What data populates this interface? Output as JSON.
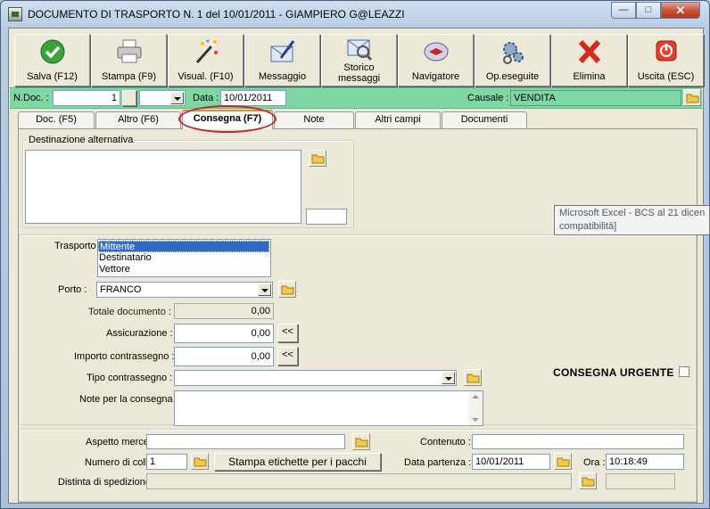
{
  "window": {
    "title": "DOCUMENTO DI TRASPORTO N. 1  del 10/01/2011 - GIAMPIERO G@LEAZZI",
    "min": "—",
    "max": "□",
    "close": "✕"
  },
  "toolbar": [
    {
      "label": "Salva (F12)",
      "icon": "save-check-icon"
    },
    {
      "label": "Stampa (F9)",
      "icon": "printer-icon"
    },
    {
      "label": "Visual. (F10)",
      "icon": "magic-wand-icon"
    },
    {
      "label": "Messaggio",
      "icon": "mail-pen-icon"
    },
    {
      "label": "Storico messaggi",
      "icon": "mail-search-icon"
    },
    {
      "label": "Navigatore",
      "icon": "compass-icon"
    },
    {
      "label": "Op.eseguite",
      "icon": "gears-icon"
    },
    {
      "label": "Elimina",
      "icon": "red-x-icon"
    },
    {
      "label": "Uscita (ESC)",
      "icon": "power-icon"
    }
  ],
  "header": {
    "ndoc_label": "N.Doc. :",
    "ndoc_value": "1",
    "data_label": "Data :",
    "data_value": "10/01/2011",
    "causale_label": "Causale :",
    "causale_value": "VENDITA"
  },
  "tabs": [
    "Doc. (F5)",
    "Altro (F6)",
    "Consegna (F7)",
    "Note",
    "Altri campi",
    "Documenti"
  ],
  "destinazione": {
    "legend": "Destinazione alternativa",
    "text": "",
    "code": ""
  },
  "trasporto": {
    "label": "Trasporto :",
    "options": [
      "Mittente",
      "Destinatario",
      "Vettore"
    ],
    "selected": "Mittente"
  },
  "porto": {
    "label": "Porto :",
    "value": "FRANCO"
  },
  "totale": {
    "label": "Totale documento :",
    "value": "0,00"
  },
  "assicurazione": {
    "label": "Assicurazione :",
    "value": "0,00",
    "btn": "<<"
  },
  "contrassegno": {
    "label": "Importo contrassegno :",
    "value": "0,00",
    "btn": "<<"
  },
  "tipo_contrassegno": {
    "label": "Tipo contrassegno :",
    "value": ""
  },
  "note_consegna": {
    "label": "Note per la consegna",
    "value": ""
  },
  "urgente": {
    "label": "CONSEGNA URGENTE",
    "checked": false
  },
  "bottom": {
    "aspetto_label": "Aspetto merce :",
    "aspetto_value": "",
    "contenuto_label": "Contenuto :",
    "contenuto_value": "",
    "colli_label": "Numero di colli :",
    "colli_value": "1",
    "stampa_btn": "Stampa etichette per i pacchi",
    "partenza_label": "Data partenza :",
    "partenza_value": "10/01/2011",
    "ora_label": "Ora :",
    "ora_value": "10:18:49",
    "distinta_label": "Distinta di spedizione :",
    "distinta_value": ""
  },
  "tooltip": {
    "line1": "Microsoft Excel - BCS al 21 dicen",
    "line2": "compatibilità]"
  },
  "colors": {
    "header_bg": "#7ed8a6",
    "selection": "#316ac5",
    "highlight_ring": "#c0282e",
    "face": "#ece9d8"
  }
}
